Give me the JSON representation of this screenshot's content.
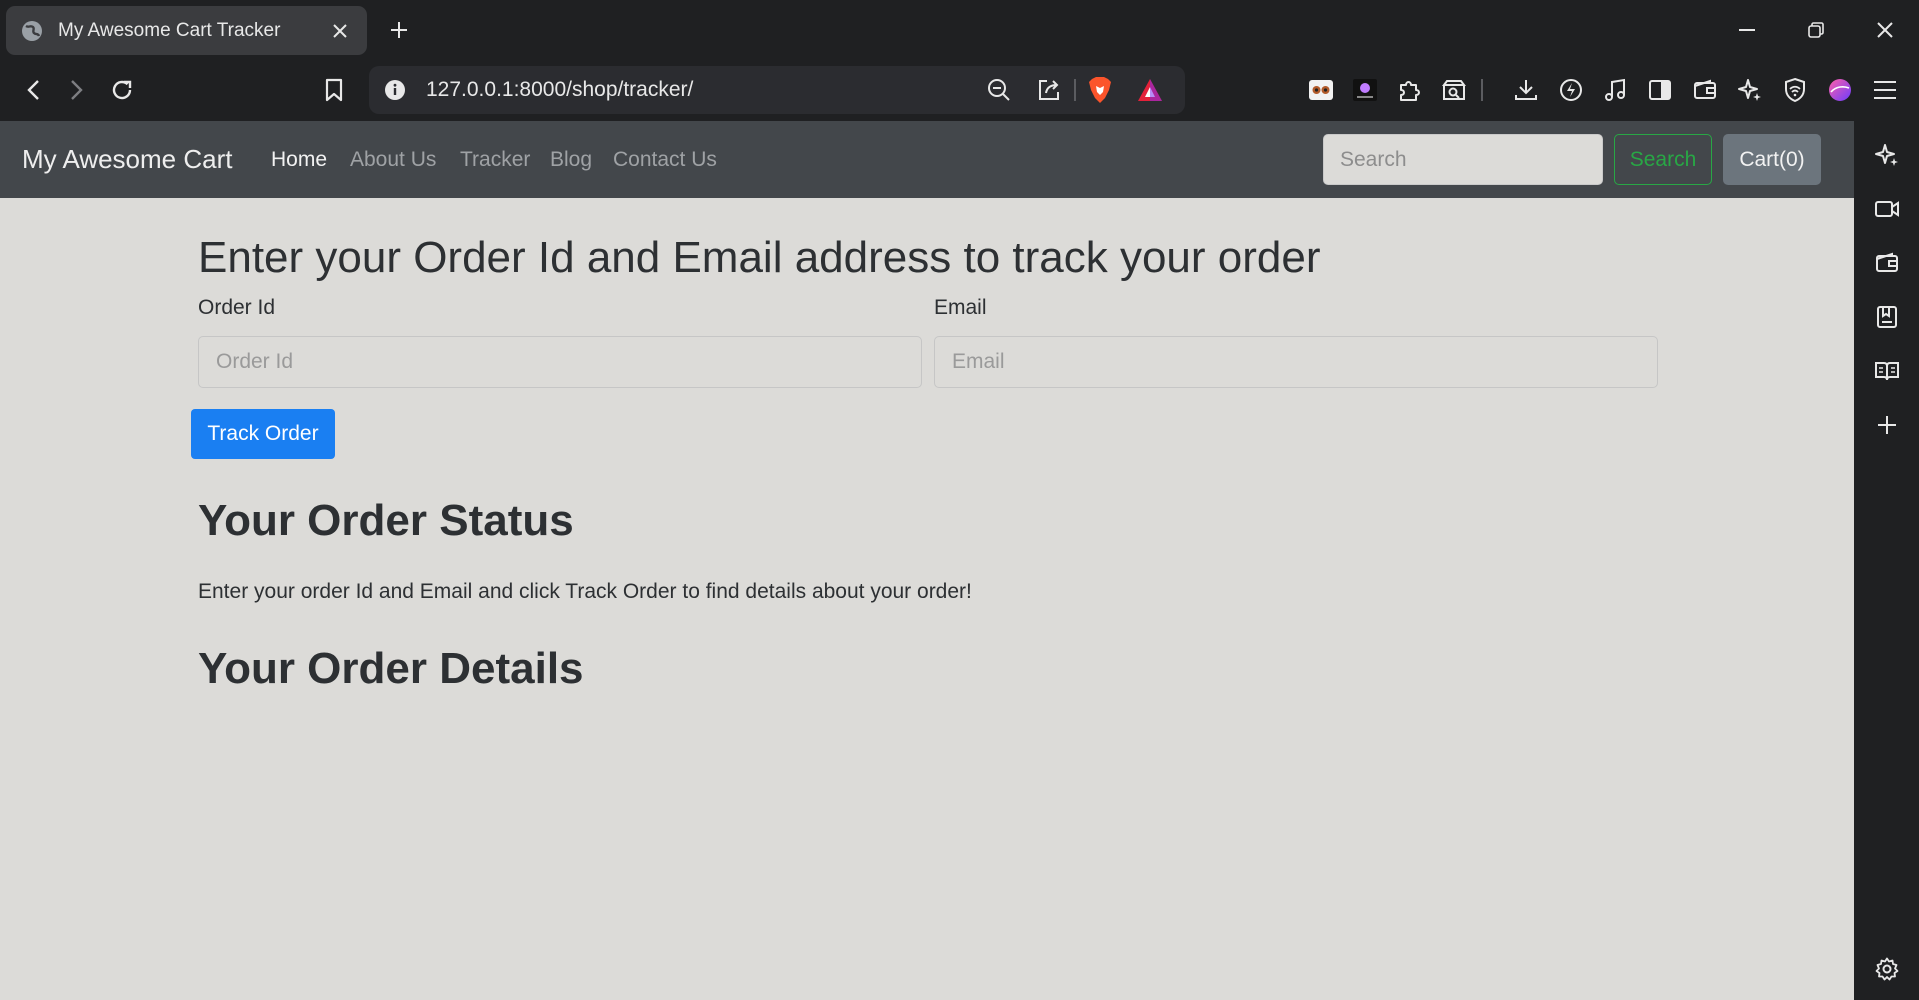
{
  "browser": {
    "tab": {
      "title": "My Awesome Cart Tracker",
      "favicon": "globe-icon"
    },
    "url": "127.0.0.1:8000/shop/tracker/"
  },
  "site": {
    "brand": "My Awesome Cart",
    "nav": [
      {
        "label": "Home",
        "active": true
      },
      {
        "label": "About Us",
        "active": false
      },
      {
        "label": "Tracker",
        "active": false
      },
      {
        "label": "Blog",
        "active": false
      },
      {
        "label": "Contact Us",
        "active": false
      }
    ],
    "search_placeholder": "Search",
    "search_button": "Search",
    "cart_button": "Cart(0)"
  },
  "tracker": {
    "heading": "Enter your Order Id and Email address to track your order",
    "order_id_label": "Order Id",
    "order_id_placeholder": "Order Id",
    "order_id_value": "",
    "email_label": "Email",
    "email_placeholder": "Email",
    "email_value": "",
    "submit_label": "Track Order"
  },
  "status": {
    "heading": "Your Order Status",
    "message": "Enter your order Id and Email and click Track Order to find details about your order!"
  },
  "details": {
    "heading": "Your Order Details"
  },
  "colors": {
    "primary": "#1a7ff2",
    "success": "#28a745",
    "secondary": "#6c757d",
    "navbar": "#43474b",
    "page_background": "#dcdbd8",
    "brave_orange": "#fb542b"
  }
}
